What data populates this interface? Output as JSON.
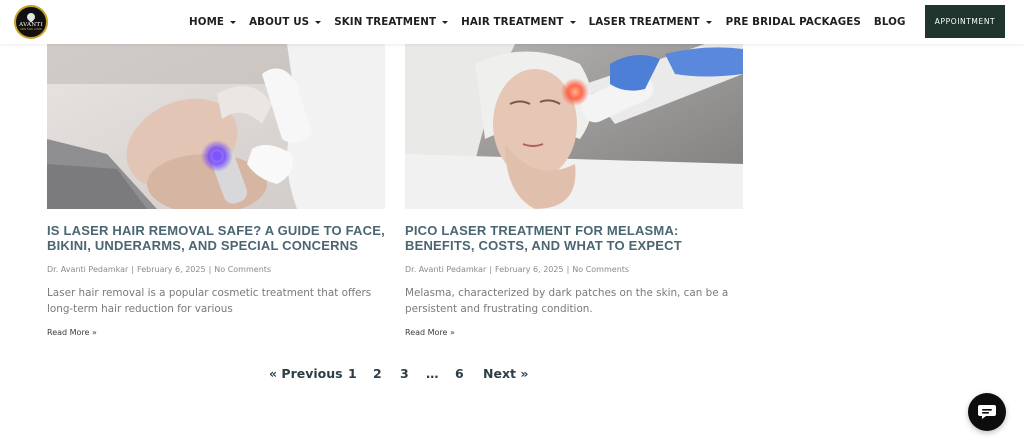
{
  "header": {
    "logo_text": "AVANTI",
    "logo_sub": "SKIN HAIR LASER",
    "nav": [
      {
        "label": "HOME",
        "has_dropdown": true
      },
      {
        "label": "ABOUT US",
        "has_dropdown": true
      },
      {
        "label": "SKIN TREATMENT",
        "has_dropdown": true
      },
      {
        "label": "HAIR TREATMENT",
        "has_dropdown": true
      },
      {
        "label": "LASER TREATMENT",
        "has_dropdown": true
      },
      {
        "label": "PRE BRIDAL PACKAGES",
        "has_dropdown": false
      },
      {
        "label": "BLOG",
        "has_dropdown": false
      }
    ],
    "appointment_label": "APPOINTMENT"
  },
  "posts": [
    {
      "title": "IS LASER HAIR REMOVAL SAFE? A GUIDE TO FACE, BIKINI, UNDERARMS, AND SPECIAL CONCERNS",
      "author": "Dr. Avanti Pedamkar",
      "date": "February 6, 2025",
      "comments": "No Comments",
      "excerpt": "Laser hair removal is a popular cosmetic treatment that offers long-term hair reduction for various",
      "read_more": "Read More »"
    },
    {
      "title": "PICO LASER TREATMENT FOR MELASMA: BENEFITS, COSTS, AND WHAT TO EXPECT",
      "author": "Dr. Avanti Pedamkar",
      "date": "February 6, 2025",
      "comments": "No Comments",
      "excerpt": "Melasma, characterized by dark patches on the skin, can be a persistent and frustrating condition.",
      "read_more": "Read More »"
    }
  ],
  "pagination": {
    "previous": "« Previous",
    "pages": [
      "1",
      "2",
      "3",
      "…",
      "6"
    ],
    "next": "Next »"
  },
  "colors": {
    "title": "#4a6670",
    "appointment_bg": "#1f342d",
    "pagination": "#2d3e48",
    "logo_ring": "#c9a227"
  },
  "icons": {
    "chat": "chat-bubble-icon"
  }
}
